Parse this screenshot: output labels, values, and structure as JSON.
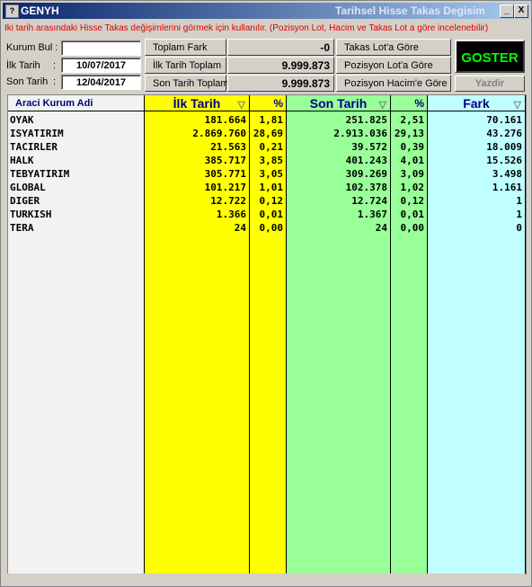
{
  "window": {
    "app_name": "GENYH",
    "title": "Tarihsel Hisse Takas Degisim",
    "icon_name": "app-icon",
    "minimize": "_",
    "close": "X"
  },
  "hint": "İki tarih arasındaki Hisse Takas değişimlerini görmek için kullanılır. (Pozisyon Lot, Hacim ve Takas Lot a göre incelenebilir)",
  "form": {
    "kurum_bul_label": "Kurum Bul :",
    "kurum_bul_value": "",
    "ilk_tarih_label": "İlk Tarih",
    "ilk_tarih_value": "10/07/2017",
    "son_tarih_label": "Son Tarih",
    "colon": ":",
    "son_tarih_value": "12/04/2017"
  },
  "summary": {
    "toplam_fark_label": "Toplam Fark",
    "toplam_fark_value": "-0",
    "ilk_tarih_toplam_label": "İlk Tarih Toplam",
    "ilk_tarih_toplam_value": "9.999.873",
    "son_tarih_toplam_label": "Son Tarih Toplam",
    "son_tarih_toplam_value": "9.999.873"
  },
  "options": {
    "takas_lot": "Takas Lot'a Göre",
    "pozisyon_lot": "Pozisyon Lot'a Göre",
    "pozisyon_hacim": "Pozisyon Hacim'e Göre"
  },
  "actions": {
    "goster": "GOSTER",
    "yazdir": "Yazdir"
  },
  "colors": {
    "yellow": "#ffff00",
    "green": "#99ff99",
    "cyan": "#c0ffff",
    "goster_text": "#00ff00",
    "hint_red": "#e00000"
  },
  "table": {
    "headers": {
      "kurum": "Araci Kurum Adi",
      "ilk": "İlk Tarih",
      "ilk_pct": "%",
      "son": "Son Tarih",
      "son_pct": "%",
      "fark": "Fark"
    },
    "sort_icon": "▽",
    "rows": [
      {
        "kurum": "OYAK",
        "ilk": "181.664",
        "ilk_pct": "1,81",
        "son": "251.825",
        "son_pct": "2,51",
        "fark": "70.161"
      },
      {
        "kurum": "ISYATIRIM",
        "ilk": "2.869.760",
        "ilk_pct": "28,69",
        "son": "2.913.036",
        "son_pct": "29,13",
        "fark": "43.276"
      },
      {
        "kurum": "TACIRLER",
        "ilk": "21.563",
        "ilk_pct": "0,21",
        "son": "39.572",
        "son_pct": "0,39",
        "fark": "18.009"
      },
      {
        "kurum": "HALK",
        "ilk": "385.717",
        "ilk_pct": "3,85",
        "son": "401.243",
        "son_pct": "4,01",
        "fark": "15.526"
      },
      {
        "kurum": "TEBYATIRIM",
        "ilk": "305.771",
        "ilk_pct": "3,05",
        "son": "309.269",
        "son_pct": "3,09",
        "fark": "3.498"
      },
      {
        "kurum": "GLOBAL",
        "ilk": "101.217",
        "ilk_pct": "1,01",
        "son": "102.378",
        "son_pct": "1,02",
        "fark": "1.161"
      },
      {
        "kurum": "DIGER",
        "ilk": "12.722",
        "ilk_pct": "0,12",
        "son": "12.724",
        "son_pct": "0,12",
        "fark": "1"
      },
      {
        "kurum": "TURKISH",
        "ilk": "1.366",
        "ilk_pct": "0,01",
        "son": "1.367",
        "son_pct": "0,01",
        "fark": "1"
      },
      {
        "kurum": "TERA",
        "ilk": "24",
        "ilk_pct": "0,00",
        "son": "24",
        "son_pct": "0,00",
        "fark": "0"
      }
    ]
  }
}
